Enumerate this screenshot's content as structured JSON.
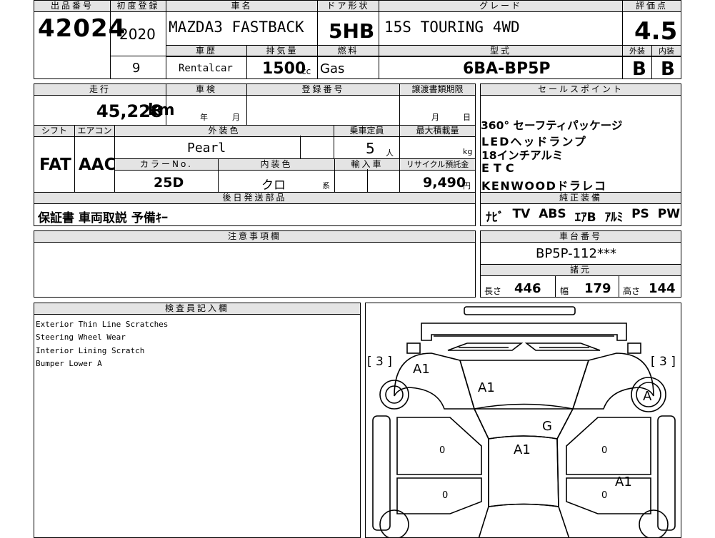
{
  "labels": {
    "lot_no": "出品番号",
    "first_reg": "初度登録",
    "car_name": "車名",
    "door": "ドア形状",
    "grade": "グレード",
    "score": "評価点",
    "history": "車歴",
    "displacement": "排気量",
    "fuel": "燃料",
    "model_code": "型式",
    "exterior": "外装",
    "interior": "内装",
    "mileage": "走行",
    "inspection": "車検",
    "reg_no": "登録番号",
    "transfer_deadline": "譲渡書類期限",
    "sale_points": "セールスポイント",
    "shift": "シフト",
    "aircon": "エアコン",
    "ext_color": "外装色",
    "capacity": "乗車定員",
    "max_load": "最大積載量",
    "color_no": "カラーNo.",
    "int_color": "内装色",
    "import": "輸入車",
    "recycle": "リサイクル預託金",
    "later_parts": "後日発送部品",
    "genuine_equipment": "純正装備",
    "notes": "注意事項欄",
    "chassis_no": "車台番号",
    "specs": "諸元",
    "inspector_notes": "検査員記入欄",
    "year": "年",
    "month": "月",
    "day": "日",
    "km": "km",
    "cc": "cc",
    "persons": "人",
    "kg": "kg",
    "yen": "円",
    "kei": "系",
    "length": "長さ",
    "width": "幅",
    "height": "高さ"
  },
  "vehicle": {
    "lot_no": "42024",
    "first_reg": "2020",
    "car_name": "MAZDA3 FASTBACK",
    "door": "5HB",
    "grade": "15S TOURING 4WD",
    "score": "4.5",
    "history": "9",
    "history_type": "Rentalcar",
    "displacement": "1500",
    "fuel": "Gas",
    "model_code": "6BA-BP5P",
    "exterior_grade": "B",
    "interior_grade": "B",
    "mileage": "45,228",
    "shift": "FAT",
    "aircon": "AAC",
    "ext_color": "Pearl",
    "capacity": "5",
    "color_no": "25D",
    "int_color": "クロ",
    "recycle": "9,490",
    "chassis_no": "BP5P-112***",
    "length": "446",
    "width": "179",
    "height": "144"
  },
  "sale_points": [
    "360° セーフティパッケージ",
    "LEDヘッドランプ",
    "18インチアルミ",
    "ETC",
    "KENWOODドラレコ"
  ],
  "later_parts": "保証書 車両取説 予備ｷｰ",
  "equipment": [
    "ﾅﾋﾞ",
    "TV",
    "ABS",
    "ｴｱB",
    "ｱﾙﾐ",
    "PS",
    "PW"
  ],
  "inspector_notes": [
    "Exterior Thin Line Scratches",
    "Steering Wheel Wear",
    "Interior Lining Scratch",
    "Bumper Lower A"
  ],
  "diagram": {
    "tread_left": "[ 3 ]",
    "tread_right": "[ 3 ]",
    "marks": {
      "front_left": "A1",
      "hood": "A1",
      "tire_right": "A",
      "windshield": "G",
      "roof": "A1",
      "right_rear_door": "A1",
      "left_door_o": "0",
      "right_door_o": "0",
      "left_rear_o": "0",
      "right_rear_o": "0"
    }
  }
}
